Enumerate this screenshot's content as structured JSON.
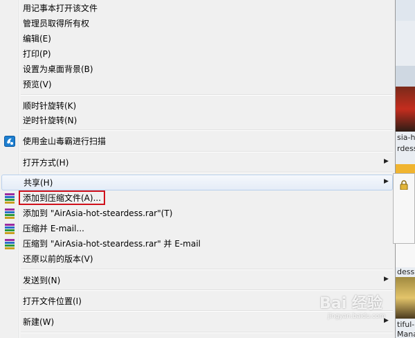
{
  "menu": {
    "items": [
      {
        "label": "用记事本打开该文件"
      },
      {
        "label": "管理员取得所有权"
      },
      {
        "label": "编辑(E)"
      },
      {
        "label": "打印(P)"
      },
      {
        "label": "设置为桌面背景(B)"
      },
      {
        "label": "预览(V)"
      },
      {
        "label": "顺时针旋转(K)"
      },
      {
        "label": "逆时针旋转(N)"
      },
      {
        "label": "使用金山毒霸进行扫描"
      },
      {
        "label": "打开方式(H)"
      },
      {
        "label": "共享(H)"
      },
      {
        "label": "添加到压缩文件(A)..."
      },
      {
        "label": "添加到 \"AirAsia-hot-steardess.rar\"(T)"
      },
      {
        "label": "压缩并 E-mail..."
      },
      {
        "label": "压缩到 \"AirAsia-hot-steardess.rar\" 并 E-mail"
      },
      {
        "label": "还原以前的版本(V)"
      },
      {
        "label": "发送到(N)"
      },
      {
        "label": "打开文件位置(I)"
      },
      {
        "label": "新建(W)"
      }
    ],
    "submenu_arrow": "▶"
  },
  "background": {
    "thumb_labels": [
      "sia-ho",
      "rdess",
      "dess",
      "tiful-l",
      "Mana"
    ]
  },
  "watermark": {
    "text": "Bai 经验",
    "sub": "jingyan.baidu.com"
  },
  "icons": {
    "scan": "kingsoft-scan-icon",
    "archive": "winrar-icon",
    "lock": "lock-icon"
  }
}
